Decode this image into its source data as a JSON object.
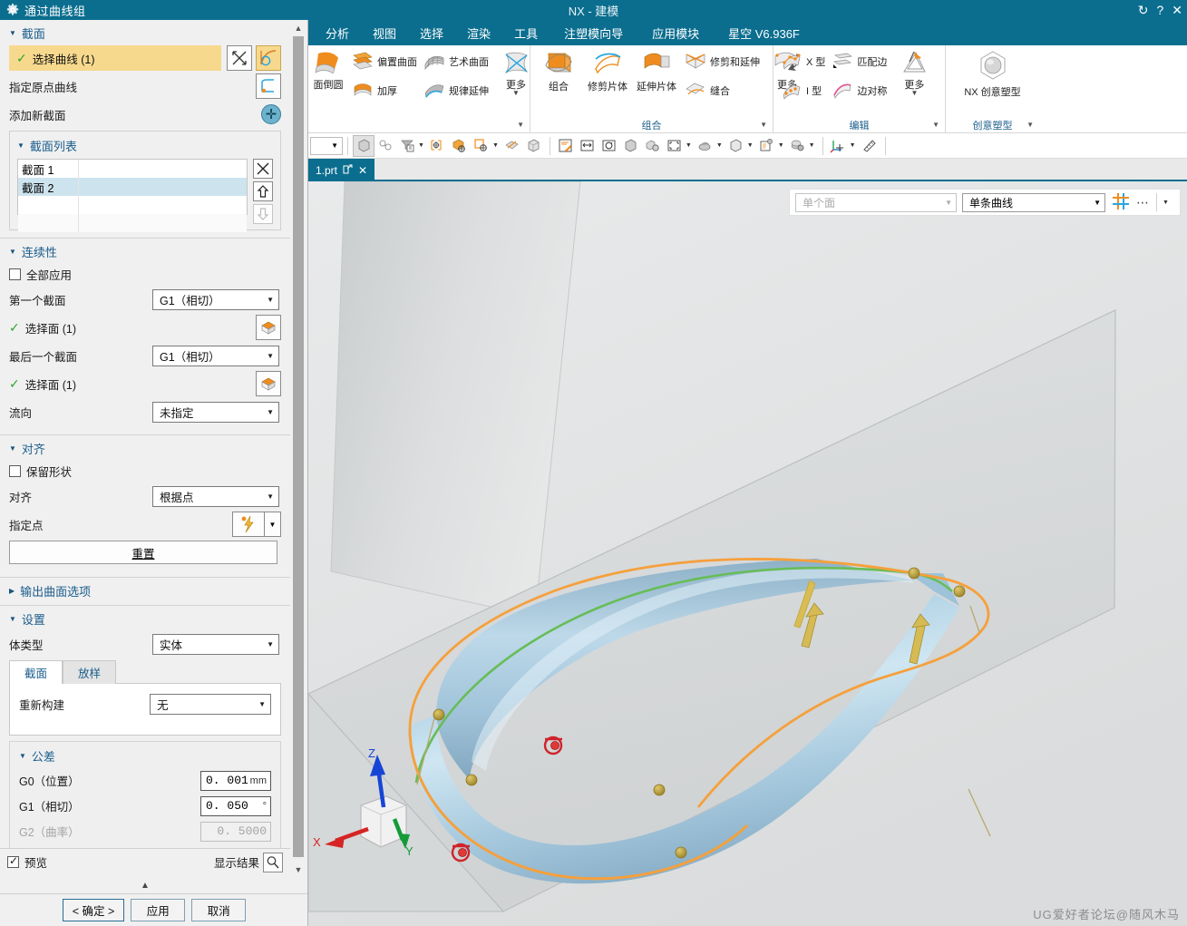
{
  "app": {
    "title": "NX - 建模",
    "watermark": "UG爱好者论坛@随风木马"
  },
  "dialog": {
    "title": "通过曲线组",
    "icons": {
      "gear": "gear-icon",
      "reset": "reset-icon",
      "help": "help-icon",
      "close": "close-icon"
    },
    "section_cross": {
      "header": "截面",
      "select_curve": "选择曲线 (1)",
      "select_curve_count": "(1)",
      "specify_origin_curve": "指定原点曲线",
      "add_new_set": "添加新截面",
      "list_header": "截面列表",
      "list_items": [
        "截面 1",
        "截面 2"
      ],
      "selected_index": 1
    },
    "section_continuity": {
      "header": "连续性",
      "apply_all": "全部应用",
      "first_section_label": "第一个截面",
      "first_section_value": "G1（相切）",
      "first_select_face": "选择面 (1)",
      "last_section_label": "最后一个截面",
      "last_section_value": "G1（相切）",
      "last_select_face": "选择面 (1)",
      "flow_label": "流向",
      "flow_value": "未指定"
    },
    "section_align": {
      "header": "对齐",
      "preserve_shape": "保留形状",
      "align_label": "对齐",
      "align_value": "根据点",
      "specify_point_label": "指定点",
      "reset_button": "重置"
    },
    "section_output": {
      "header": "输出曲面选项"
    },
    "section_settings": {
      "header": "设置",
      "body_type_label": "体类型",
      "body_type_value": "实体",
      "tabs": [
        "截面",
        "放样"
      ],
      "active_tab": 0,
      "rebuild_label": "重新构建",
      "rebuild_value": "无"
    },
    "section_tolerance": {
      "header": "公差",
      "rows": [
        {
          "label": "G0（位置）",
          "value": "0. 001",
          "unit": "mm",
          "disabled": false
        },
        {
          "label": "G1（相切）",
          "value": "0. 050",
          "unit": "°",
          "disabled": false
        },
        {
          "label": "G2（曲率）",
          "value": "0. 5000",
          "unit": "",
          "disabled": true
        }
      ]
    },
    "footer": {
      "preview_label": "预览",
      "preview_checked": true,
      "show_result_label": "显示结果",
      "ok": "< 确定 >",
      "apply": "应用",
      "cancel": "取消"
    }
  },
  "ribbon": {
    "tabs": [
      "分析",
      "视图",
      "选择",
      "渲染",
      "工具",
      "注塑模向导",
      "应用模块",
      "星空 V6.936F"
    ],
    "groups": [
      {
        "label": "",
        "big_left": "面倒圆",
        "items": [
          {
            "label": "偏置曲面",
            "icon": "offset-surface-icon"
          },
          {
            "label": "加厚",
            "icon": "thicken-icon"
          },
          {
            "label": "艺术曲面",
            "icon": "art-surface-icon"
          },
          {
            "label": "规律延伸",
            "icon": "law-extension-icon"
          },
          {
            "label": "更多",
            "icon": "more-icon"
          }
        ]
      },
      {
        "label": "组合",
        "items": [
          {
            "label": "组合",
            "icon": "combine-icon"
          },
          {
            "label": "修剪片体",
            "icon": "trim-sheet-icon"
          },
          {
            "label": "延伸片体",
            "icon": "extend-sheet-icon"
          },
          {
            "label": "修剪和延伸",
            "icon": "trim-extend-icon"
          },
          {
            "label": "缝合",
            "icon": "sew-icon"
          },
          {
            "label": "更多",
            "icon": "more-icon"
          }
        ]
      },
      {
        "label": "编辑",
        "items": [
          {
            "label": "X 型",
            "icon": "x-form-icon"
          },
          {
            "label": "I 型",
            "icon": "i-form-icon"
          },
          {
            "label": "匹配边",
            "icon": "match-edge-icon"
          },
          {
            "label": "边对称",
            "icon": "edge-symmetry-icon"
          },
          {
            "label": "更多",
            "icon": "more-icon"
          }
        ]
      },
      {
        "label": "创意塑型",
        "items": [
          {
            "label": "NX 创意塑型",
            "icon": "realize-shape-icon"
          }
        ]
      }
    ]
  },
  "file_tab": {
    "name": "1.prt",
    "detach_icon": "detach-icon",
    "close_icon": "close-icon"
  },
  "selection_bar": {
    "face_filter_value": "单个面",
    "curve_filter_value": "单条曲线",
    "snap_icon": "snap-point-icon",
    "more_icon": "more-dots-icon"
  },
  "viewport": {
    "triad": {
      "x": "X",
      "y": "Y",
      "z": "Z"
    },
    "colors": {
      "section1_curve": "#f2a03c",
      "section2_curve": "#73c062",
      "surface_light": "#cfe4f0",
      "surface_mid": "#a7cadf",
      "surface_dark": "#7fa8c0",
      "point_marker": "#b59b34",
      "origin_marker": "#d93025",
      "plane": "#d7d9da",
      "background": "#e4e6e7"
    }
  }
}
